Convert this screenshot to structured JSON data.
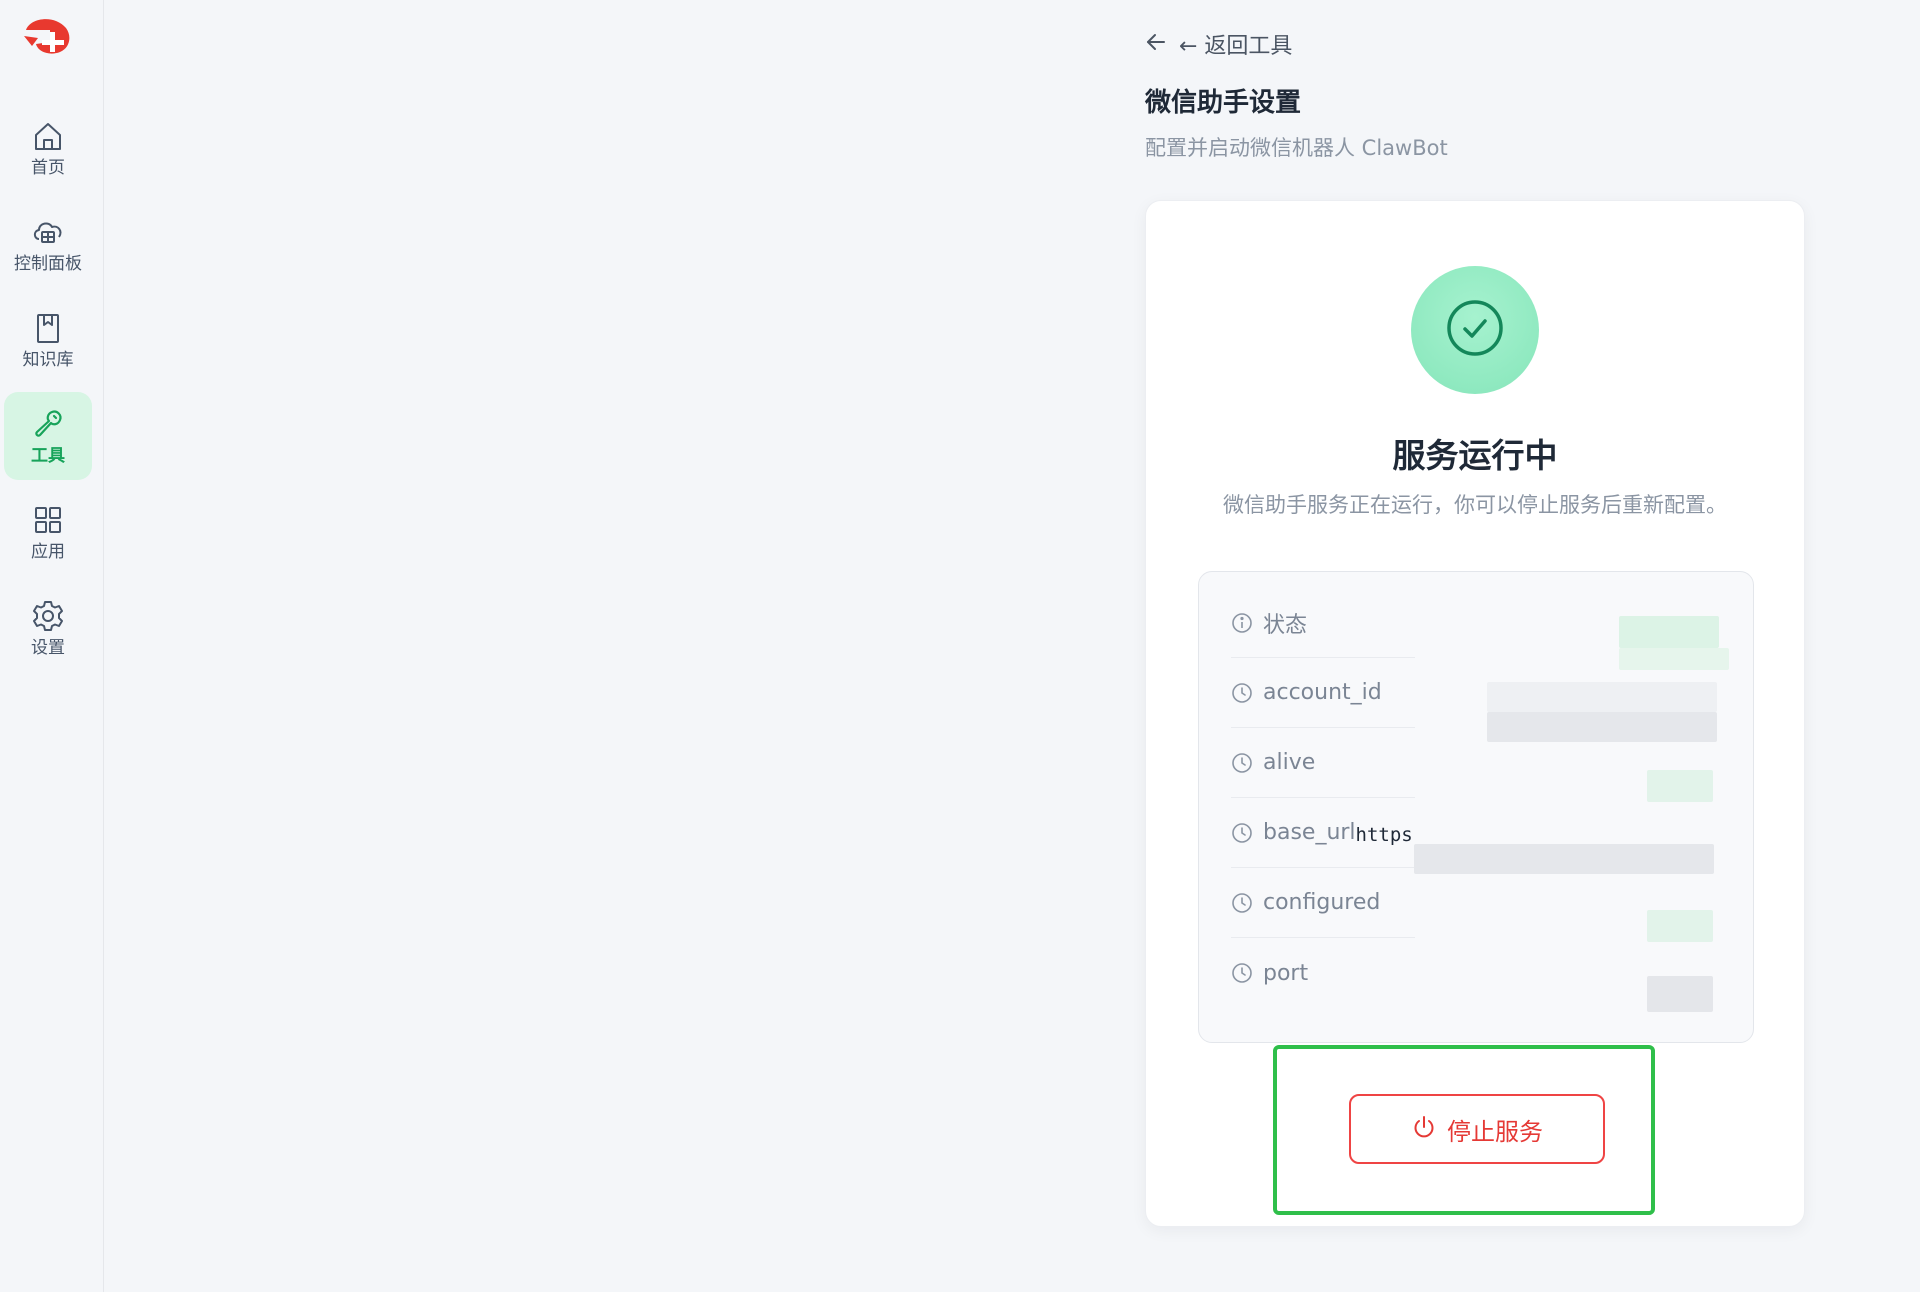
{
  "sidebar": {
    "items": [
      {
        "label": "首页",
        "icon": "home-icon"
      },
      {
        "label": "控制面板",
        "icon": "dashboard-icon"
      },
      {
        "label": "知识库",
        "icon": "book-icon"
      },
      {
        "label": "工具",
        "icon": "wrench-icon",
        "active": true
      },
      {
        "label": "应用",
        "icon": "grid-icon"
      },
      {
        "label": "设置",
        "icon": "gear-icon"
      }
    ]
  },
  "header": {
    "back_label": "← 返回工具",
    "title": "微信助手设置",
    "subtitle": "配置并启动微信机器人 ClawBot"
  },
  "status": {
    "title": "服务运行中",
    "description": "微信助手服务正在运行，你可以停止服务后重新配置。"
  },
  "info": {
    "rows": [
      {
        "label": "状态",
        "icon": "info-icon"
      },
      {
        "label": "account_id",
        "icon": "clock-icon"
      },
      {
        "label": "alive",
        "icon": "clock-icon"
      },
      {
        "label": "base_url",
        "icon": "clock-icon",
        "value_prefix": "https"
      },
      {
        "label": "configured",
        "icon": "clock-icon"
      },
      {
        "label": "port",
        "icon": "clock-icon"
      }
    ]
  },
  "actions": {
    "stop_label": "停止服务"
  },
  "colors": {
    "accent": "#17a35a",
    "active_bg": "#d7f5e4",
    "danger": "#e53935",
    "highlight": "#2fbf4a"
  }
}
